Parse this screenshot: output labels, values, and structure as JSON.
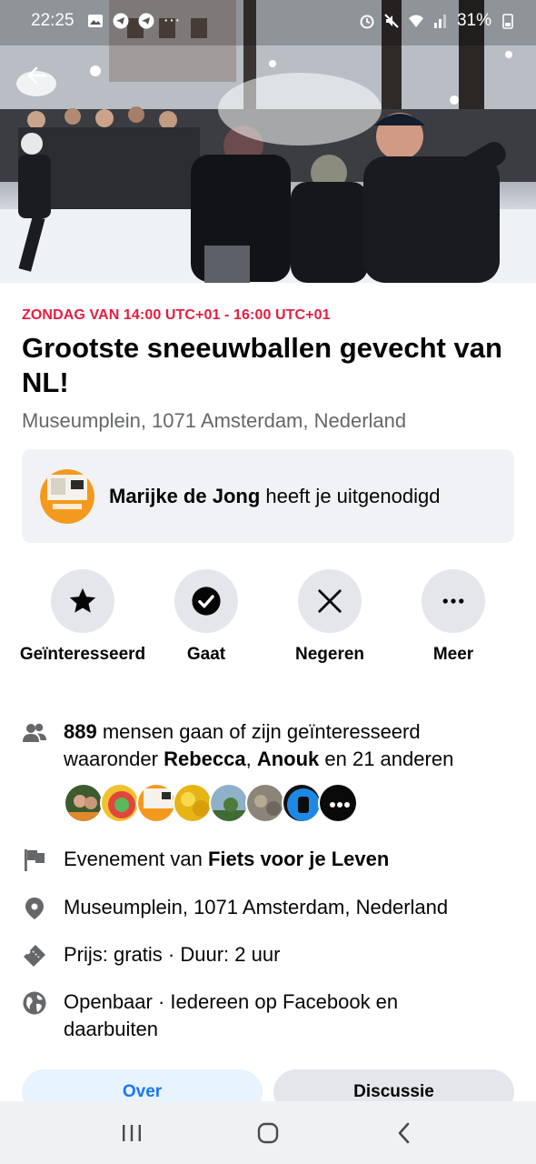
{
  "status_bar": {
    "time": "22:25",
    "dots": "···",
    "battery": "31%"
  },
  "event": {
    "date_line": "ZONDAG VAN 14:00 UTC+01 - 16:00 UTC+01",
    "title": "Grootste sneeuwballen gevecht van NL!",
    "location_subtitle": "Museumplein, 1071 Amsterdam, Nederland"
  },
  "invite": {
    "inviter": "Marijke de Jong",
    "text": " heeft je uitgenodigd"
  },
  "actions": [
    {
      "label": "Geïnteresseerd",
      "icon": "star-icon"
    },
    {
      "label": "Gaat",
      "icon": "check-circle-icon"
    },
    {
      "label": "Negeren",
      "icon": "close-icon"
    },
    {
      "label": "Meer",
      "icon": "more-icon"
    }
  ],
  "details": {
    "going_count": "889",
    "going_text": " mensen gaan of zijn geïnteresseerd",
    "among_prefix": "waaronder ",
    "friend1": "Rebecca",
    "sep": ", ",
    "friend2": "Anouk",
    "among_suffix": " en 21 anderen",
    "organizer_prefix": "Evenement van ",
    "organizer": "Fiets voor je Leven",
    "location": "Museumplein, 1071 Amsterdam, Nederland",
    "price_duration": "Prijs: gratis · Duur: 2 uur",
    "privacy": "Openbaar · Iedereen op Facebook en daarbuiten"
  },
  "tabs": [
    {
      "label": "Over"
    },
    {
      "label": "Discussie"
    }
  ],
  "colors": {
    "accent": "#1877f2",
    "date_red": "#e41e3f",
    "secondary_text": "#65676b",
    "button_bg": "#e4e6eb"
  }
}
